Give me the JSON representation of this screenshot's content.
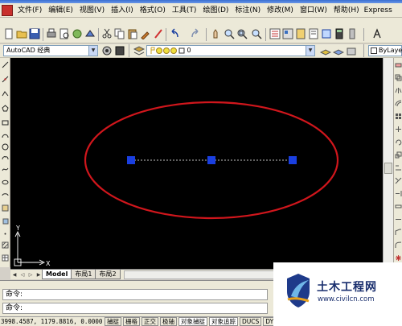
{
  "menu": {
    "items": [
      "文件(F)",
      "编辑(E)",
      "视图(V)",
      "插入(I)",
      "格式(O)",
      "工具(T)",
      "绘图(D)",
      "标注(N)",
      "修改(M)",
      "窗口(W)",
      "帮助(H)"
    ],
    "express": "Express"
  },
  "workspace": {
    "name": "AutoCAD 经典",
    "layer": "0",
    "linetype": "ByLayer"
  },
  "tabs": {
    "items": [
      "Model",
      "布局1",
      "布局2"
    ],
    "active": "Model"
  },
  "command": {
    "prompt1": "命令:",
    "prompt2": "命令:"
  },
  "status": {
    "coords": "3998.4587, 1179.8816, 0.0000",
    "buttons": [
      "捕捉",
      "栅格",
      "正交",
      "极轴",
      "对象捕捉",
      "对象追踪",
      "DUCS",
      "DYN"
    ]
  },
  "ucs": {
    "y_label": "Y",
    "x_label": "X"
  },
  "watermark": {
    "title": "土木工程网",
    "url": "www.civilcn.com"
  },
  "colors": {
    "ellipse": "#d0161c",
    "grip": "#1a3fe0",
    "canvas": "#000000"
  }
}
